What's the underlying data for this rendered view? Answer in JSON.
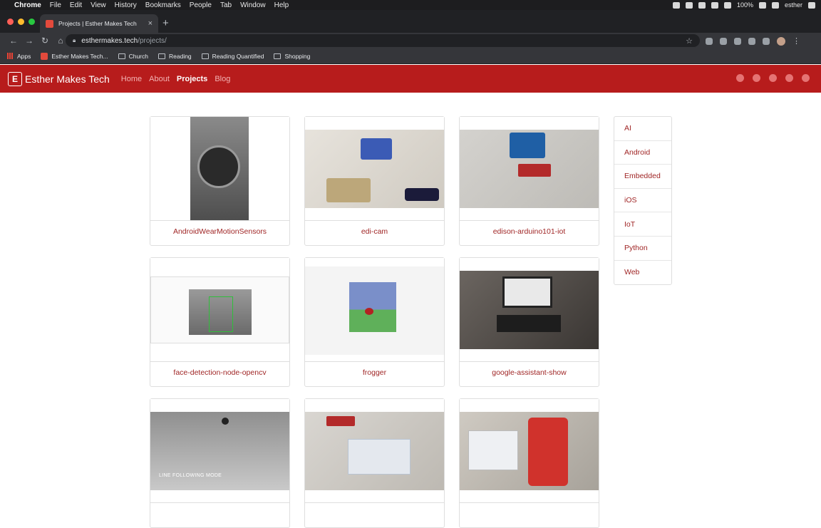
{
  "menubar": {
    "app": "Chrome",
    "items": [
      "File",
      "Edit",
      "View",
      "History",
      "Bookmarks",
      "People",
      "Tab",
      "Window",
      "Help"
    ],
    "battery": "100%",
    "user": "esther"
  },
  "browser": {
    "tab_title": "Projects | Esther Makes Tech",
    "url_host": "esthermakes.tech",
    "url_path": "/projects/",
    "bookmarks": [
      "Apps",
      "Esther Makes Tech...",
      "Church",
      "Reading",
      "Reading Quantified",
      "Shopping"
    ]
  },
  "site": {
    "logo_letter": "E",
    "brand": "Esther Makes Tech",
    "nav": [
      "Home",
      "About",
      "Projects",
      "Blog"
    ],
    "active_nav": "Projects",
    "accent": "#b71c1c"
  },
  "projects": [
    {
      "title": "AndroidWearMotionSensors"
    },
    {
      "title": "edi-cam"
    },
    {
      "title": "edison-arduino101-iot"
    },
    {
      "title": "face-detection-node-opencv"
    },
    {
      "title": "frogger"
    },
    {
      "title": "google-assistant-show"
    },
    {
      "title": "",
      "overlay": "LINE FOLLOWING MODE"
    },
    {
      "title": ""
    },
    {
      "title": ""
    }
  ],
  "categories": [
    "AI",
    "Android",
    "Embedded",
    "iOS",
    "IoT",
    "Python",
    "Web"
  ]
}
